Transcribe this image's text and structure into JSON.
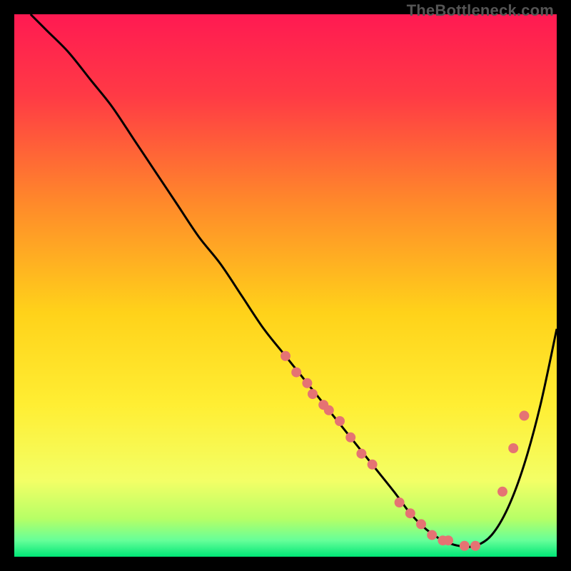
{
  "watermark": "TheBottleneck.com",
  "chart_data": {
    "type": "line",
    "title": "",
    "xlabel": "",
    "ylabel": "",
    "xlim": [
      0,
      100
    ],
    "ylim": [
      0,
      100
    ],
    "gradient_stops": [
      {
        "offset": 0.0,
        "color": "#ff1a52"
      },
      {
        "offset": 0.15,
        "color": "#ff3a45"
      },
      {
        "offset": 0.35,
        "color": "#ff8a2a"
      },
      {
        "offset": 0.55,
        "color": "#ffd21a"
      },
      {
        "offset": 0.72,
        "color": "#ffee33"
      },
      {
        "offset": 0.86,
        "color": "#f3ff66"
      },
      {
        "offset": 0.93,
        "color": "#b6ff66"
      },
      {
        "offset": 0.97,
        "color": "#66ff99"
      },
      {
        "offset": 1.0,
        "color": "#00e676"
      }
    ],
    "curve": {
      "name": "bottleneck-curve",
      "x": [
        3,
        6,
        10,
        14,
        18,
        22,
        26,
        30,
        34,
        38,
        42,
        46,
        50,
        54,
        58,
        62,
        66,
        70,
        73,
        76,
        79,
        82,
        85,
        88,
        91,
        94,
        97,
        100
      ],
      "y": [
        100,
        97,
        93,
        88,
        83,
        77,
        71,
        65,
        59,
        54,
        48,
        42,
        37,
        32,
        27,
        22,
        17,
        12,
        8,
        5,
        3,
        2,
        2,
        4,
        9,
        17,
        28,
        42
      ]
    },
    "markers": {
      "name": "highlight-points",
      "color": "#e57373",
      "radius": 7,
      "points": [
        {
          "x": 50,
          "y": 37
        },
        {
          "x": 52,
          "y": 34
        },
        {
          "x": 54,
          "y": 32
        },
        {
          "x": 55,
          "y": 30
        },
        {
          "x": 57,
          "y": 28
        },
        {
          "x": 58,
          "y": 27
        },
        {
          "x": 60,
          "y": 25
        },
        {
          "x": 62,
          "y": 22
        },
        {
          "x": 64,
          "y": 19
        },
        {
          "x": 66,
          "y": 17
        },
        {
          "x": 71,
          "y": 10
        },
        {
          "x": 73,
          "y": 8
        },
        {
          "x": 75,
          "y": 6
        },
        {
          "x": 77,
          "y": 4
        },
        {
          "x": 79,
          "y": 3
        },
        {
          "x": 80,
          "y": 3
        },
        {
          "x": 83,
          "y": 2
        },
        {
          "x": 85,
          "y": 2
        },
        {
          "x": 90,
          "y": 12
        },
        {
          "x": 92,
          "y": 20
        },
        {
          "x": 94,
          "y": 26
        }
      ]
    }
  }
}
